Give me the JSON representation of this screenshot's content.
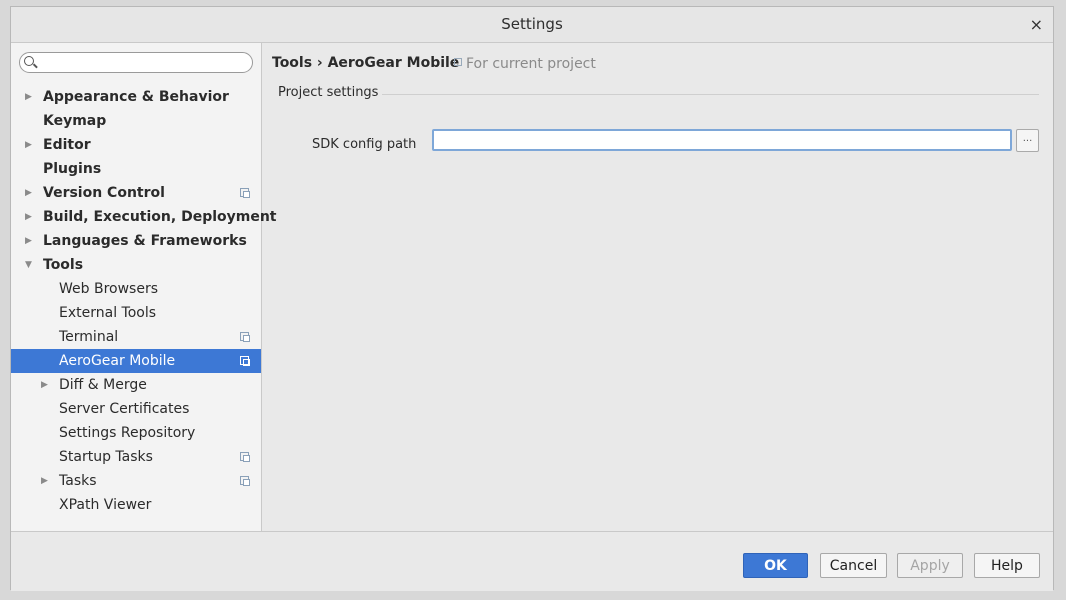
{
  "window": {
    "title": "Settings",
    "close_glyph": "×"
  },
  "search": {
    "placeholder": "",
    "value": ""
  },
  "tree": [
    {
      "label": "Appearance & Behavior",
      "level": 0,
      "arrow": "▶",
      "scope": false
    },
    {
      "label": "Keymap",
      "level": 0,
      "arrow": "",
      "scope": false
    },
    {
      "label": "Editor",
      "level": 0,
      "arrow": "▶",
      "scope": false
    },
    {
      "label": "Plugins",
      "level": 0,
      "arrow": "",
      "scope": false
    },
    {
      "label": "Version Control",
      "level": 0,
      "arrow": "▶",
      "scope": true
    },
    {
      "label": "Build, Execution, Deployment",
      "level": 0,
      "arrow": "▶",
      "scope": false
    },
    {
      "label": "Languages & Frameworks",
      "level": 0,
      "arrow": "▶",
      "scope": false
    },
    {
      "label": "Tools",
      "level": 0,
      "arrow": "▼",
      "scope": false
    },
    {
      "label": "Web Browsers",
      "level": 1,
      "arrow": "",
      "scope": false
    },
    {
      "label": "External Tools",
      "level": 1,
      "arrow": "",
      "scope": false
    },
    {
      "label": "Terminal",
      "level": 1,
      "arrow": "",
      "scope": true
    },
    {
      "label": "AeroGear Mobile",
      "level": 1,
      "arrow": "",
      "scope": true,
      "selected": true
    },
    {
      "label": "Diff & Merge",
      "level": 1,
      "arrow": "▶",
      "scope": false
    },
    {
      "label": "Server Certificates",
      "level": 1,
      "arrow": "",
      "scope": false
    },
    {
      "label": "Settings Repository",
      "level": 1,
      "arrow": "",
      "scope": false
    },
    {
      "label": "Startup Tasks",
      "level": 1,
      "arrow": "",
      "scope": true
    },
    {
      "label": "Tasks",
      "level": 1,
      "arrow": "▶",
      "scope": true
    },
    {
      "label": "XPath Viewer",
      "level": 1,
      "arrow": "",
      "scope": false
    }
  ],
  "breadcrumb": {
    "text": "Tools › AeroGear Mobile",
    "scope": "For current project"
  },
  "section": {
    "title": "Project settings"
  },
  "form": {
    "sdk_label": "SDK config path",
    "sdk_value": "",
    "browse_label": "..."
  },
  "buttons": {
    "ok": "OK",
    "cancel": "Cancel",
    "apply": "Apply",
    "help": "Help"
  },
  "colors": {
    "accent": "#3d78d5",
    "background": "#e9e9e9",
    "sidebar": "#f3f3f3"
  },
  "icons": {
    "scope_icon": "project-scope-icon"
  }
}
